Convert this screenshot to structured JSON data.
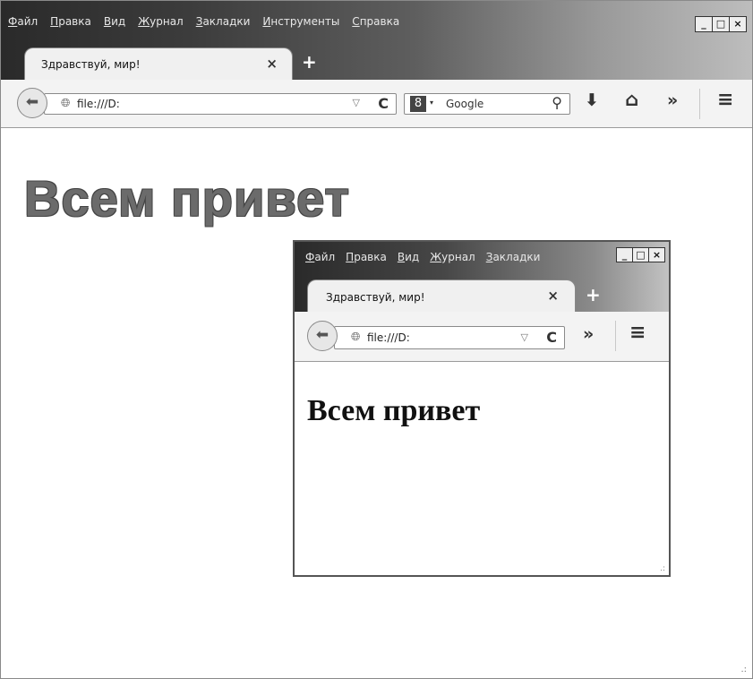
{
  "menu": [
    "Файл",
    "Правка",
    "Вид",
    "Журнал",
    "Закладки",
    "Инструменты",
    "Справка"
  ],
  "window_buttons": {
    "minimize": "_",
    "maximize": "□",
    "close": "×"
  },
  "tab": {
    "title": "Здравствуй, мир!",
    "close": "×",
    "new_tab": "+"
  },
  "toolbar": {
    "url": "file:///D:",
    "dropdown": "▽",
    "reload": "C",
    "search_engine_icon": "8",
    "search_engine_arrow": "▾",
    "search_placeholder": "Google",
    "search_icon": "⚲",
    "download": "⬇",
    "home": "⌂",
    "overflow": "»",
    "menu": "≡"
  },
  "page": {
    "heading": "Всем привет"
  },
  "inner_window": {
    "menu": [
      "Файл",
      "Правка",
      "Вид",
      "Журнал",
      "Закладки"
    ],
    "tab": {
      "title": "Здравствуй, мир!",
      "close": "×",
      "new_tab": "+"
    },
    "url": "file:///D:",
    "page": {
      "heading": "Всем привет"
    }
  },
  "icons": [
    "back-arrow-icon",
    "globe-icon",
    "dropdown-icon",
    "reload-icon",
    "search-engine-icon",
    "magnifier-icon",
    "download-icon",
    "home-icon",
    "overflow-icon",
    "menu-icon",
    "resize-grip-icon"
  ]
}
